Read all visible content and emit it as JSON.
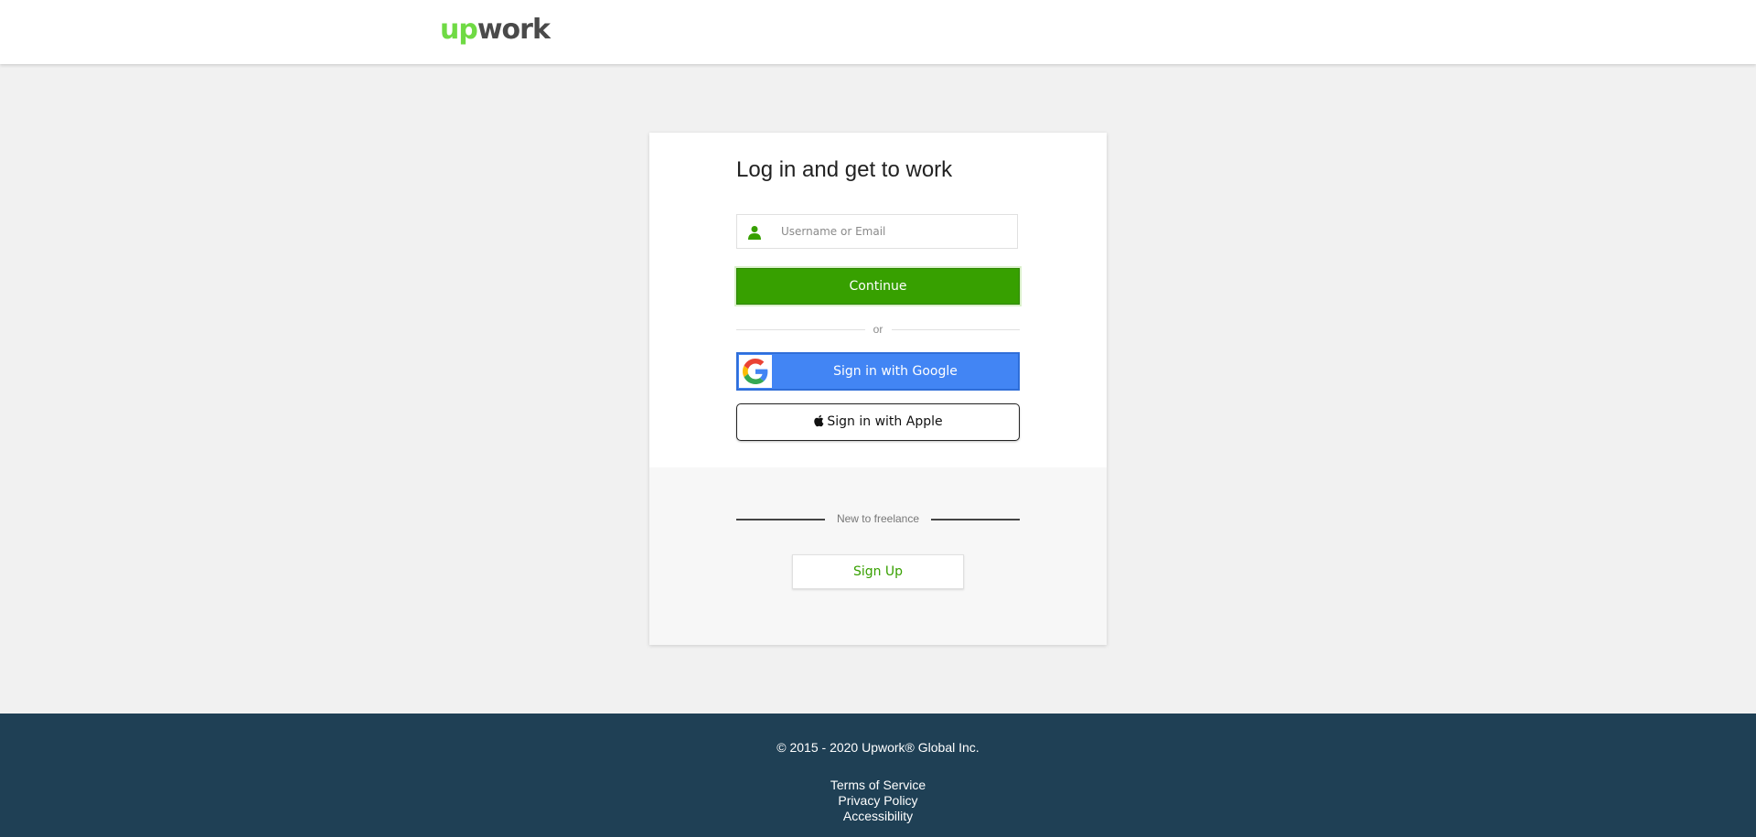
{
  "header": {
    "logo_up": "up",
    "logo_work": "work"
  },
  "login": {
    "title": "Log in and get to work",
    "username_placeholder": "Username or Email",
    "username_value": "",
    "continue_label": "Continue",
    "or_label": "or",
    "google_label": "Sign in with Google",
    "apple_label": "Sign in with Apple"
  },
  "signup": {
    "divider_label": "New to freelance",
    "button_label": "Sign Up"
  },
  "footer": {
    "copyright": "© 2015 - 2020 Upwork® Global Inc.",
    "links": [
      "Terms of Service",
      "Privacy Policy",
      "Accessibility"
    ]
  },
  "colors": {
    "brand_green": "#37a000",
    "logo_green": "#6fda44",
    "google_blue": "#4285f4",
    "footer_bg": "#1f4055",
    "page_bg": "#f1f1f1"
  },
  "icons": {
    "user": "user-icon",
    "google": "google-g-icon",
    "apple": "apple-icon"
  }
}
